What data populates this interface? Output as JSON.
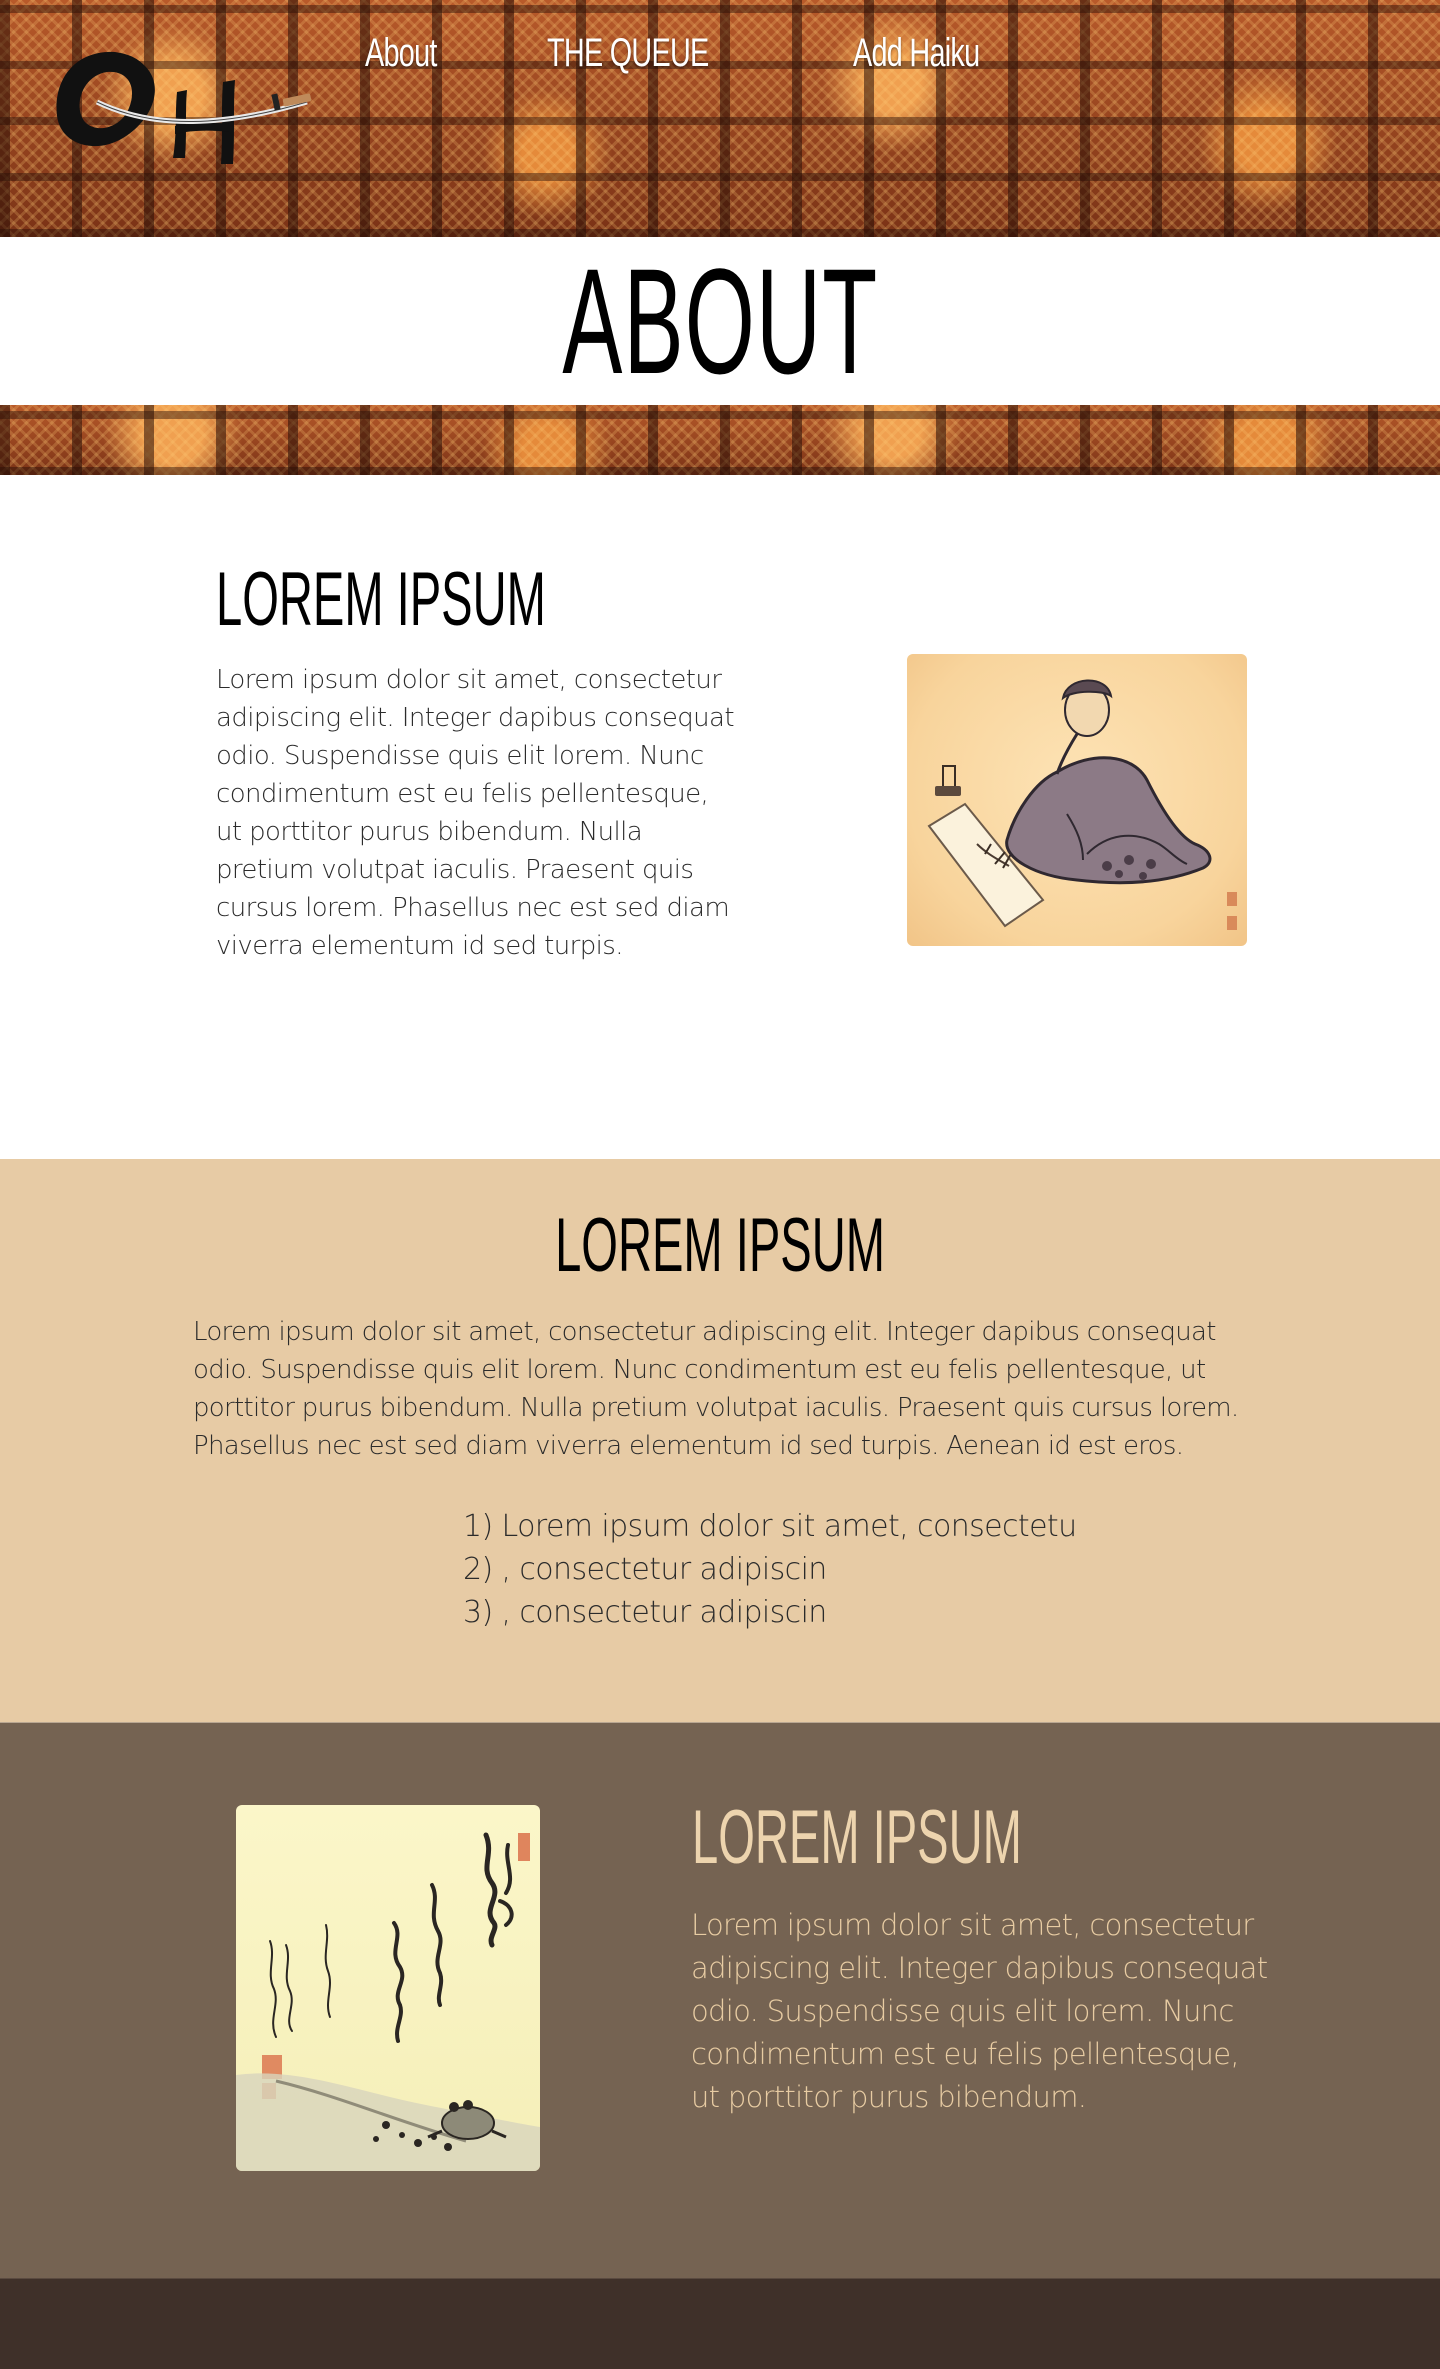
{
  "nav": {
    "items": [
      {
        "label": "About"
      },
      {
        "label": "THE QUEUE"
      },
      {
        "label": "Add Haiku"
      }
    ]
  },
  "page": {
    "title": "ABOUT"
  },
  "section1": {
    "heading": "LOREM IPSUM",
    "body": "Lorem ipsum dolor sit amet, consectetur adipiscing elit. Integer dapibus consequat odio. Suspendisse quis elit lorem. Nunc condimentum est eu felis pellentesque, ut porttitor purus bibendum. Nulla pretium volutpat iaculis. Praesent quis cursus lorem. Phasellus nec est sed diam viverra elementum id sed turpis."
  },
  "section2": {
    "heading": "LOREM IPSUM",
    "body": "Lorem ipsum dolor sit amet, consectetur adipiscing elit. Integer dapibus consequat odio. Suspendisse quis elit lorem. Nunc condimentum est eu felis pellentesque, ut porttitor purus bibendum. Nulla pretium volutpat iaculis. Praesent quis cursus lorem. Phasellus nec est sed diam viverra elementum id sed turpis. Aenean id est eros.",
    "list": [
      "1) Lorem ipsum dolor sit amet, consectetu",
      "2) , consectetur adipiscin",
      "3) , consectetur adipiscin"
    ]
  },
  "section3": {
    "heading": "LOREM IPSUM",
    "body": "Lorem ipsum dolor sit amet, consectetur adipiscing elit. Integer dapibus consequat odio. Suspendisse quis elit lorem. Nunc condimentum est eu felis pellentesque, ut porttitor purus bibendum."
  },
  "colors": {
    "tan_section": "#e7cba5",
    "brown_section": "#756352",
    "footer": "#3f3029",
    "heading_light": "#edd4ae"
  },
  "icons": {
    "logo": "oh-brush-logo"
  }
}
